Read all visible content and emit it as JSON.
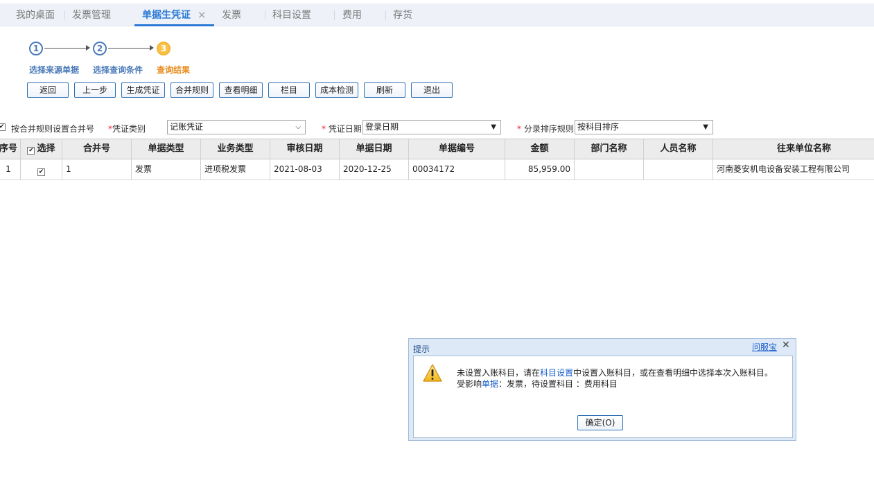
{
  "tabs": [
    {
      "label": "我的桌面"
    },
    {
      "label": "发票管理"
    },
    {
      "label": "单据生凭证",
      "active": true
    },
    {
      "label": "发票"
    },
    {
      "label": "科目设置"
    },
    {
      "label": "费用"
    },
    {
      "label": "存货"
    }
  ],
  "tab_close_glyph": "✕",
  "steps": [
    {
      "number": "1",
      "label": "选择来源单据"
    },
    {
      "number": "2",
      "label": "选择查询条件"
    },
    {
      "number": "3",
      "label": "查询结果",
      "current": true
    }
  ],
  "toolbar": {
    "back": "返回",
    "prev_step": "上一步",
    "generate_voucher": "生成凭证",
    "merge_rules": "合并规则",
    "view_detail": "查看明细",
    "columns": "栏目",
    "cost_check": "成本检测",
    "refresh": "刷新",
    "exit": "退出"
  },
  "filters": {
    "merge_checkbox_label": "按合并规则设置合并号",
    "merge_checkbox_checked": true,
    "required_mark": "*",
    "voucher_type_label": "凭证类别",
    "voucher_type_value": "记账凭证",
    "voucher_date_label": "凭证日期",
    "voucher_date_value": "登录日期",
    "sort_rule_label": "分录排序规则",
    "sort_rule_value": "按科目排序"
  },
  "table": {
    "headers": {
      "seq": "序号",
      "select": "选择",
      "merge_no": "合并号",
      "doc_type": "单据类型",
      "biz_type": "业务类型",
      "audit_date": "审核日期",
      "doc_date": "单据日期",
      "doc_no": "单据编号",
      "amount": "金额",
      "dept": "部门名称",
      "person": "人员名称",
      "partner": "往来单位名称"
    },
    "rows": [
      {
        "seq": "1",
        "selected": true,
        "merge_no": "1",
        "doc_type": "发票",
        "biz_type": "进项税发票",
        "audit_date": "2021-08-03",
        "doc_date": "2020-12-25",
        "doc_no": "00034172",
        "amount": "85,959.00",
        "dept": "",
        "person": "",
        "partner": "河南菱安机电设备安装工程有限公司"
      }
    ]
  },
  "dialog": {
    "title": "提示",
    "help_link": "问服宝",
    "close_glyph": "✕",
    "line1_a": "未设置入账科目，请在",
    "line1_link": "科目设置",
    "line1_b": "中设置入账科目，或在查看明细中选择本次入账科目。",
    "line2_a": "受影响",
    "line2_link": "单据",
    "line2_b": "：发票，待设置科目 ：费用科目",
    "ok_button": "确定(O)"
  },
  "colors": {
    "accent": "#2a7ad6",
    "step_done": "#4a7ab8",
    "step_current": "#f8c24a",
    "link": "#1a5fcc"
  }
}
